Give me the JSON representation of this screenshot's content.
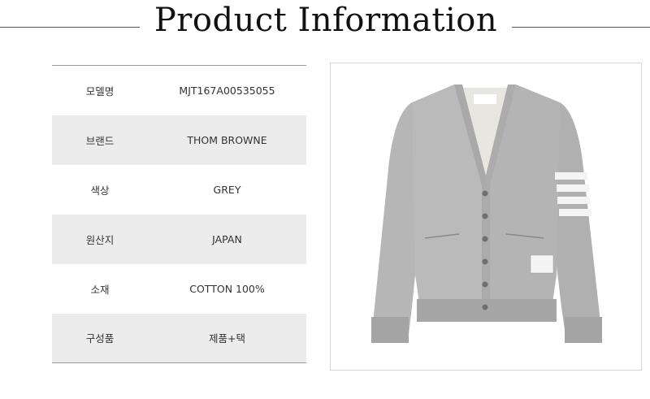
{
  "page_title": "Product Information",
  "info_rows": [
    {
      "label": "모델명",
      "value": "MJT167A00535055"
    },
    {
      "label": "브랜드",
      "value": "THOM BROWNE"
    },
    {
      "label": "색상",
      "value": "GREY"
    },
    {
      "label": "원산지",
      "value": "JAPAN"
    },
    {
      "label": "소재",
      "value": "COTTON 100%"
    },
    {
      "label": "구성품",
      "value": "제품+택"
    }
  ],
  "product_image": {
    "icon": "grey-cardigan-photo",
    "colors": {
      "body": "#b6b6b6",
      "trim": "#a8a8a8",
      "lining": "#e8e6e1",
      "stripes": "#f4f4f4",
      "buttons": "#6f6f6f"
    }
  }
}
